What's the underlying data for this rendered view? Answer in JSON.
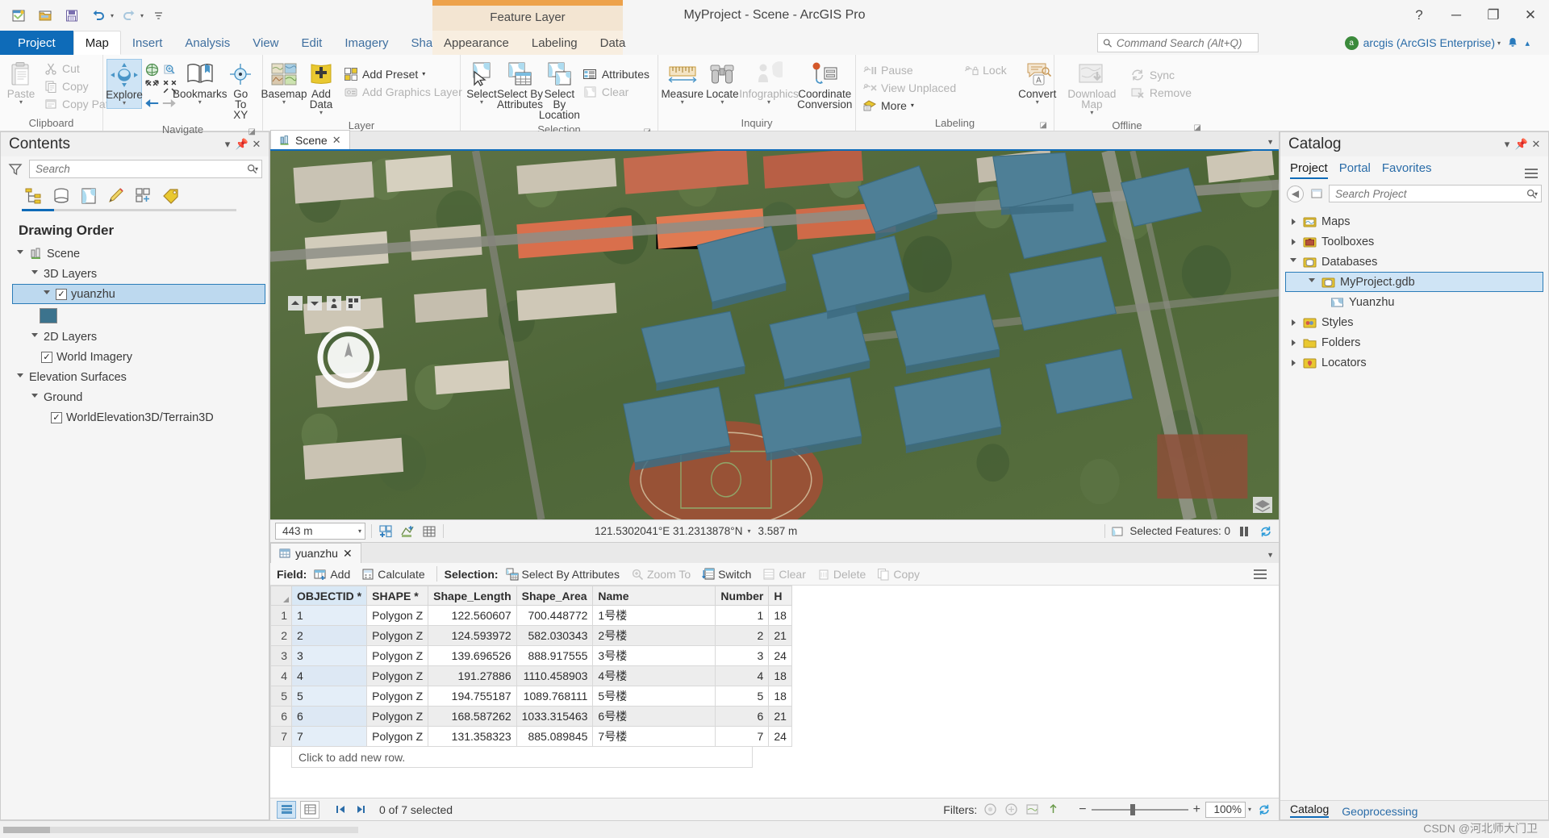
{
  "window": {
    "title": "MyProject - Scene - ArcGIS Pro",
    "contextual_tab_group": "Feature Layer",
    "help_icon": "?",
    "minimize_icon": "─",
    "maximize_icon": "❐",
    "close_icon": "✕"
  },
  "quick_access": [
    {
      "name": "new-project-icon",
      "tip": "New Project"
    },
    {
      "name": "open-project-icon",
      "tip": "Open Project"
    },
    {
      "name": "save-project-icon",
      "tip": "Save Project"
    },
    {
      "name": "undo-icon",
      "tip": "Undo"
    },
    {
      "name": "redo-icon",
      "tip": "Redo"
    },
    {
      "name": "customize-qat-icon",
      "tip": "Customize Quick Access Toolbar"
    }
  ],
  "tabs": {
    "project": "Project",
    "main": [
      "Map",
      "Insert",
      "Analysis",
      "View",
      "Edit",
      "Imagery",
      "Share"
    ],
    "active_main": "Map",
    "contextual": [
      "Appearance",
      "Labeling",
      "Data"
    ]
  },
  "command_search": {
    "placeholder": "Command Search (Alt+Q)"
  },
  "account": {
    "label": "arcgis (ArcGIS Enterprise)",
    "initial": "a"
  },
  "ribbon": {
    "groups": [
      {
        "title": "Clipboard",
        "has_dialog_launcher": false,
        "big": [
          {
            "label": "Paste",
            "icon": "paste-icon",
            "dropdown": true,
            "disabled": true
          }
        ],
        "small": [
          {
            "label": "Cut",
            "icon": "cut-icon",
            "disabled": true
          },
          {
            "label": "Copy",
            "icon": "copy-icon",
            "disabled": true
          },
          {
            "label": "Copy Path",
            "icon": "copy-path-icon",
            "disabled": true
          }
        ]
      },
      {
        "title": "Navigate",
        "has_dialog_launcher": true,
        "big": [
          {
            "label": "Explore",
            "icon": "explore-icon",
            "dropdown": true,
            "selected": true
          },
          {
            "label": "Bookmarks",
            "icon": "bookmarks-icon",
            "dropdown": true
          },
          {
            "label": "Go To XY",
            "icon": "go-to-xy-icon",
            "dropdown": false
          }
        ],
        "nav_icons": [
          "full-extent-icon",
          "fixed-zoom-in-icon",
          "zoom-to-selection-icon",
          "zoom-to-previous-extent-icon",
          "previous-extent-icon",
          "next-extent-icon"
        ]
      },
      {
        "title": "Layer",
        "has_dialog_launcher": false,
        "big": [
          {
            "label": "Basemap",
            "icon": "basemap-icon",
            "dropdown": true
          },
          {
            "label": "Add Data",
            "icon": "add-data-icon",
            "dropdown": true
          }
        ],
        "small": [
          {
            "label": "Add Preset",
            "icon": "add-preset-icon",
            "dropdown": true
          },
          {
            "label": "Add Graphics Layer",
            "icon": "add-graphics-layer-icon",
            "disabled": true
          }
        ]
      },
      {
        "title": "Selection",
        "has_dialog_launcher": true,
        "big": [
          {
            "label": "Select",
            "icon": "select-icon",
            "dropdown": true
          },
          {
            "label": "Select By Attributes",
            "icon": "select-by-attributes-icon"
          },
          {
            "label": "Select By Location",
            "icon": "select-by-location-icon"
          }
        ],
        "small": [
          {
            "label": "Attributes",
            "icon": "attributes-icon"
          },
          {
            "label": "Clear",
            "icon": "clear-selection-icon",
            "disabled": true
          }
        ]
      },
      {
        "title": "Inquiry",
        "has_dialog_launcher": false,
        "big": [
          {
            "label": "Measure",
            "icon": "measure-icon",
            "dropdown": true
          },
          {
            "label": "Locate",
            "icon": "locate-icon",
            "dropdown": true
          },
          {
            "label": "Infographics",
            "icon": "infographics-icon",
            "dropdown": true,
            "disabled": true
          },
          {
            "label": "Coordinate Conversion",
            "icon": "coordinate-conversion-icon"
          }
        ]
      },
      {
        "title": "Labeling",
        "has_dialog_launcher": true,
        "small": [
          {
            "label": "Pause",
            "icon": "pause-labeling-icon",
            "disabled": true
          },
          {
            "label": "View Unplaced",
            "icon": "view-unplaced-icon",
            "disabled": true
          },
          {
            "label": "More",
            "icon": "more-labeling-icon",
            "dropdown": true
          }
        ],
        "small2": [
          {
            "label": "Lock",
            "icon": "lock-labeling-icon",
            "disabled": true
          }
        ],
        "big": [
          {
            "label": "Convert",
            "icon": "convert-labels-icon",
            "dropdown": true
          }
        ]
      },
      {
        "title": "Offline",
        "has_dialog_launcher": true,
        "big": [
          {
            "label": "Download Map",
            "icon": "download-map-icon",
            "dropdown": true,
            "disabled": true
          }
        ],
        "small": [
          {
            "label": "Sync",
            "icon": "sync-icon",
            "disabled": true
          },
          {
            "label": "Remove",
            "icon": "remove-offline-icon",
            "disabled": true
          }
        ]
      }
    ]
  },
  "contents_pane": {
    "title": "Contents",
    "search_placeholder": "Search",
    "tab_icons": [
      "list-by-drawing-order-icon",
      "list-by-data-source-icon",
      "list-by-selection-icon",
      "list-by-editing-icon",
      "list-by-snapping-icon",
      "list-by-labeling-icon"
    ],
    "section_title": "Drawing Order",
    "tree": [
      {
        "label": "Scene",
        "level": 0,
        "icon": "scene-icon",
        "expander": "open"
      },
      {
        "label": "3D Layers",
        "level": 1,
        "expander": "open"
      },
      {
        "label": "yuanzhu",
        "level": 2,
        "expander": "open",
        "checkbox": true,
        "checked": true,
        "selected": true
      },
      {
        "label": "",
        "level": 3,
        "swatch": "#3c738d"
      },
      {
        "label": "2D Layers",
        "level": 1,
        "expander": "open"
      },
      {
        "label": "World Imagery",
        "level": 2,
        "checkbox": true,
        "checked": true
      },
      {
        "label": "Elevation Surfaces",
        "level": 1,
        "expander": "open"
      },
      {
        "label": "Ground",
        "level": 2,
        "expander": "open"
      },
      {
        "label": "WorldElevation3D/Terrain3D",
        "level": 3,
        "checkbox": true,
        "checked": true
      }
    ]
  },
  "map_view": {
    "tab_label": "Scene",
    "tab_icon": "scene-tab-icon",
    "scale": "443 m",
    "coordinates": "121.5302041°E 31.2313878°N",
    "elevation": "3.587 m",
    "selected_features": "Selected Features: 0",
    "toolbar_icons": [
      "add-new-selection-icon",
      "measure-tool-icon",
      "grid-icon"
    ],
    "pause_icon": "pause-drawing-icon",
    "refresh_icon": "refresh-icon",
    "compass_label": "N",
    "nav_widget_icons": [
      "up-arrow-icon",
      "down-arrow-icon",
      "person-icon",
      "layout-icon"
    ]
  },
  "attribute_table": {
    "tab_label": "yuanzhu",
    "toolbar": {
      "field_label": "Field:",
      "add_label": "Add",
      "calculate_label": "Calculate",
      "selection_label": "Selection:",
      "select_by_attributes": "Select By Attributes",
      "zoom_to": "Zoom To",
      "switch": "Switch",
      "clear": "Clear",
      "delete": "Delete",
      "copy": "Copy"
    },
    "columns": [
      "OBJECTID *",
      "SHAPE *",
      "Shape_Length",
      "Shape_Area",
      "Name",
      "Number",
      "H"
    ],
    "rows": [
      {
        "n": "1",
        "OBJECTID": "1",
        "SHAPE": "Polygon Z",
        "Shape_Length": "122.560607",
        "Shape_Area": "700.448772",
        "Name": "1号楼",
        "Number": "1",
        "H": "18"
      },
      {
        "n": "2",
        "OBJECTID": "2",
        "SHAPE": "Polygon Z",
        "Shape_Length": "124.593972",
        "Shape_Area": "582.030343",
        "Name": "2号楼",
        "Number": "2",
        "H": "21"
      },
      {
        "n": "3",
        "OBJECTID": "3",
        "SHAPE": "Polygon Z",
        "Shape_Length": "139.696526",
        "Shape_Area": "888.917555",
        "Name": "3号楼",
        "Number": "3",
        "H": "24"
      },
      {
        "n": "4",
        "OBJECTID": "4",
        "SHAPE": "Polygon Z",
        "Shape_Length": "191.27886",
        "Shape_Area": "1110.458903",
        "Name": "4号楼",
        "Number": "4",
        "H": "18"
      },
      {
        "n": "5",
        "OBJECTID": "5",
        "SHAPE": "Polygon Z",
        "Shape_Length": "194.755187",
        "Shape_Area": "1089.768111",
        "Name": "5号楼",
        "Number": "5",
        "H": "18"
      },
      {
        "n": "6",
        "OBJECTID": "6",
        "SHAPE": "Polygon Z",
        "Shape_Length": "168.587262",
        "Shape_Area": "1033.315463",
        "Name": "6号楼",
        "Number": "6",
        "H": "21"
      },
      {
        "n": "7",
        "OBJECTID": "7",
        "SHAPE": "Polygon Z",
        "Shape_Length": "131.358323",
        "Shape_Area": "885.089845",
        "Name": "7号楼",
        "Number": "7",
        "H": "24"
      }
    ],
    "add_row_text": "Click to add new row.",
    "status": {
      "selected_text": "0 of 7 selected",
      "filters_label": "Filters:",
      "zoom_level": "100%",
      "minus": "−",
      "plus": "+",
      "first_icon": "first-record-icon",
      "next_icon": "next-record-icon",
      "view_table_icon": "table-view-icon",
      "view_form_icon": "form-view-icon",
      "filter_icons": [
        "filter-none-icon",
        "filter-selected-icon",
        "filter-extent-icon",
        "filter-ascending-icon"
      ],
      "refresh_icon": "refresh-table-icon"
    }
  },
  "catalog_pane": {
    "title": "Catalog",
    "tabs": [
      "Project",
      "Portal",
      "Favorites"
    ],
    "active_tab": "Project",
    "search_placeholder": "Search Project",
    "tree": [
      {
        "label": "Maps",
        "icon": "maps-folder-icon",
        "level": 0,
        "expander": "closed"
      },
      {
        "label": "Toolboxes",
        "icon": "toolboxes-folder-icon",
        "level": 0,
        "expander": "closed"
      },
      {
        "label": "Databases",
        "icon": "databases-folder-icon",
        "level": 0,
        "expander": "open"
      },
      {
        "label": "MyProject.gdb",
        "icon": "geodatabase-icon",
        "level": 1,
        "expander": "open",
        "selected": true
      },
      {
        "label": "Yuanzhu",
        "icon": "feature-class-icon",
        "level": 2
      },
      {
        "label": "Styles",
        "icon": "styles-folder-icon",
        "level": 0,
        "expander": "closed"
      },
      {
        "label": "Folders",
        "icon": "folders-icon",
        "level": 0,
        "expander": "closed"
      },
      {
        "label": "Locators",
        "icon": "locators-folder-icon",
        "level": 0,
        "expander": "closed"
      }
    ],
    "footer_tabs": [
      "Catalog",
      "Geoprocessing"
    ],
    "footer_active": "Catalog"
  },
  "watermark": "CSDN @河北师大门卫",
  "colors": {
    "accent": "#0e6bb8",
    "contextual": "#eda24b",
    "layer_fill": "#3c738d",
    "project_tab": "#0e6bb8"
  }
}
